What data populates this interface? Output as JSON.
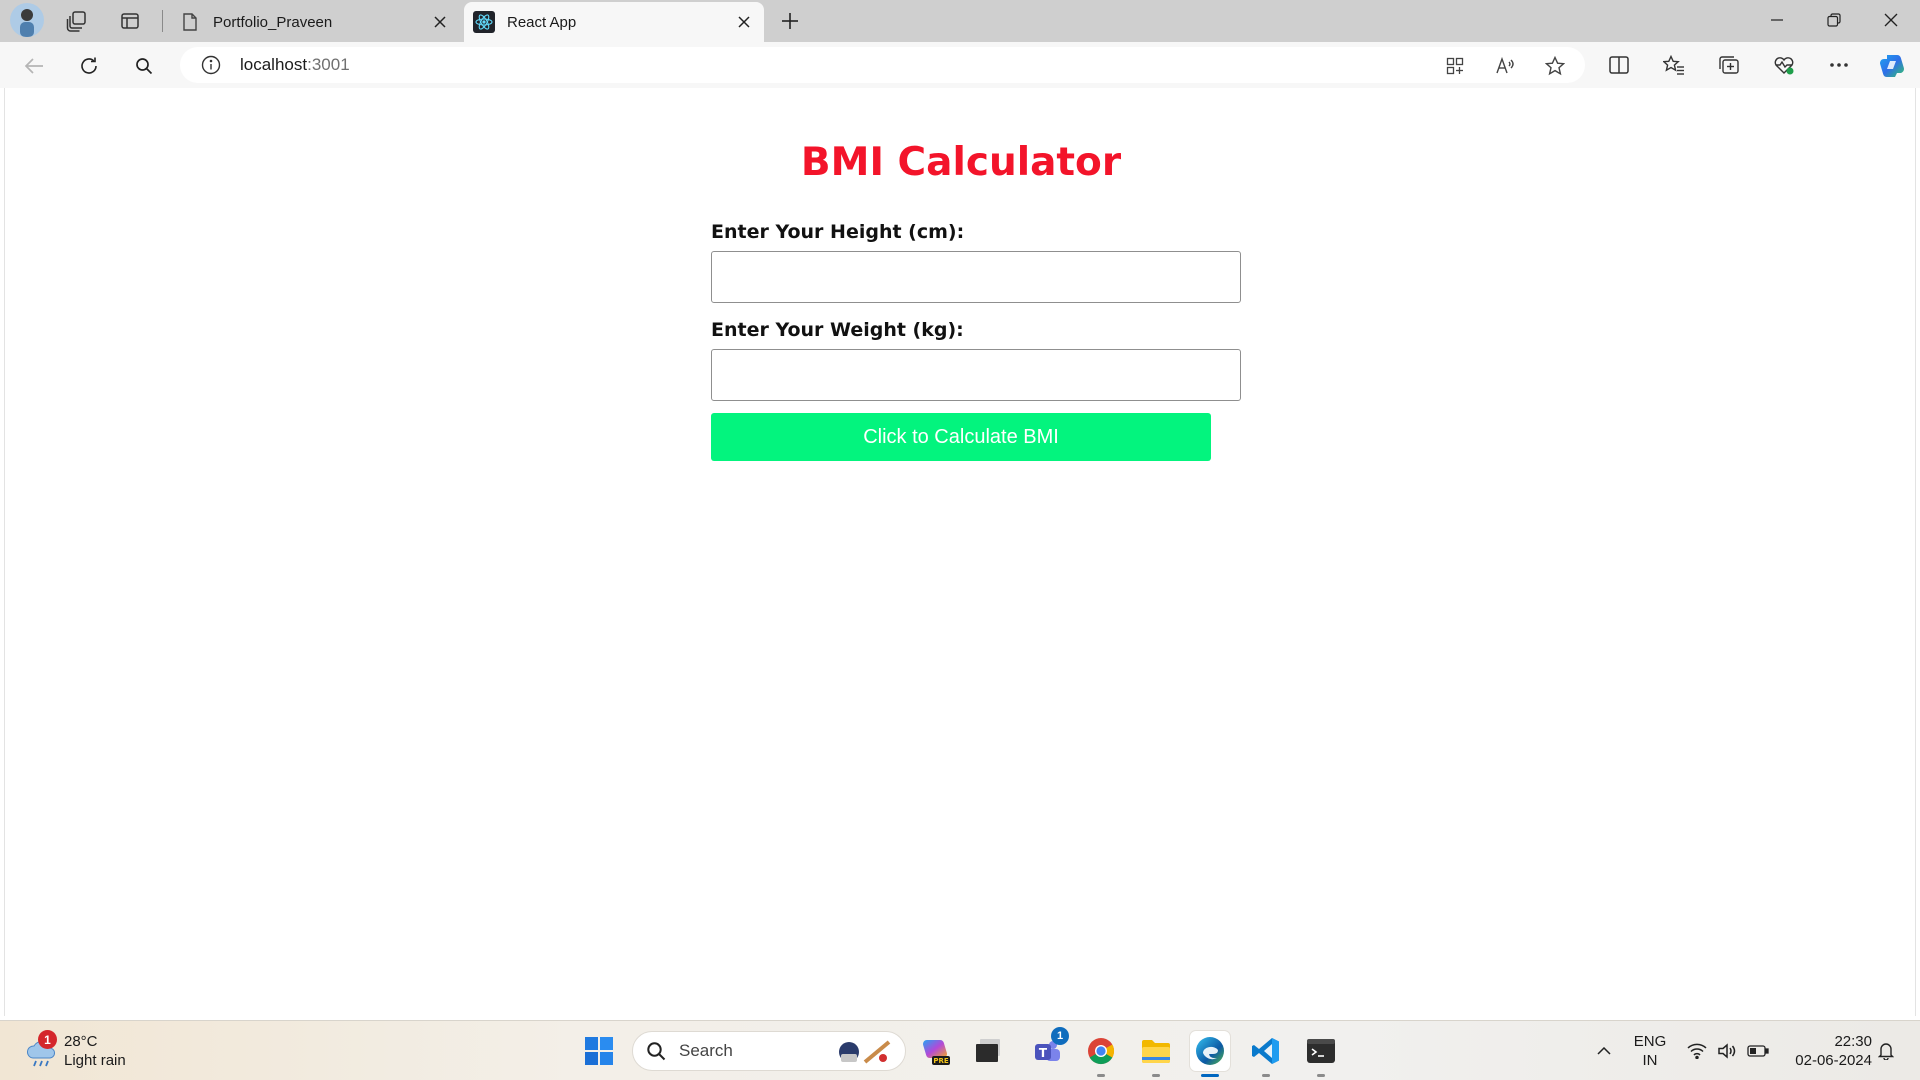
{
  "browser": {
    "tabs": [
      {
        "title": "Portfolio_Praveen",
        "active": false,
        "favicon": "page-icon"
      },
      {
        "title": "React App",
        "active": true,
        "favicon": "react-icon"
      }
    ],
    "address": {
      "host": "localhost",
      "port": ":3001"
    },
    "icons": {
      "profile": "profile-avatar",
      "workspaces": "workspaces-icon",
      "tab_actions": "vertical-tabs-icon",
      "new_tab": "plus-icon",
      "back": "back-arrow-icon",
      "refresh": "refresh-icon",
      "search": "search-icon",
      "site_info": "info-icon",
      "app_available": "app-available-icon",
      "read_aloud": "read-aloud-icon",
      "favorite": "star-icon",
      "split_screen": "split-screen-icon",
      "favorites": "favorites-icon",
      "collections": "collections-icon",
      "browser_essentials": "heart-pulse-icon",
      "more": "more-icon",
      "copilot": "copilot-icon"
    }
  },
  "page": {
    "title": "BMI Calculator",
    "height_label": "Enter Your Height (cm):",
    "height_value": "",
    "weight_label": "Enter Your Weight (kg):",
    "weight_value": "",
    "button_label": "Click to Calculate BMI",
    "colors": {
      "title": "#f3142a",
      "button_bg": "#03f47e",
      "button_text": "#ffffff"
    }
  },
  "taskbar": {
    "weather": {
      "temp": "28°C",
      "condition": "Light rain",
      "badge": "1"
    },
    "search_label": "Search",
    "teams_badge": "1",
    "apps": [
      "windows-start",
      "search",
      "copilot-pre",
      "task-view",
      "teams",
      "chrome",
      "file-explorer",
      "edge",
      "vscode",
      "terminal"
    ],
    "language": {
      "lang": "ENG",
      "region": "IN"
    },
    "clock": {
      "time": "22:30",
      "date": "02-06-2024"
    }
  }
}
